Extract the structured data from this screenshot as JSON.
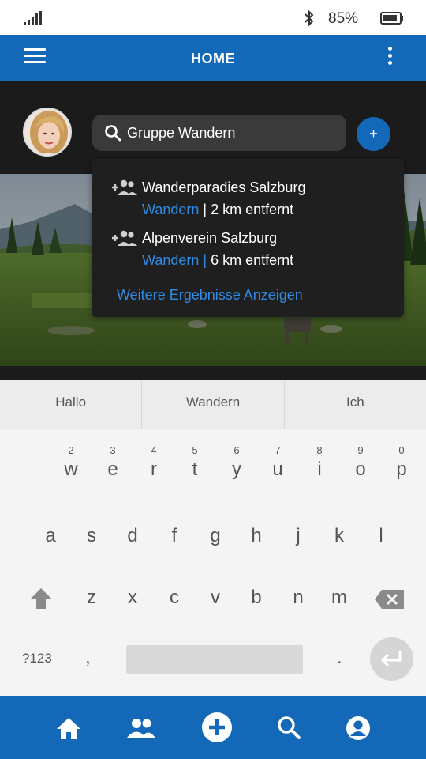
{
  "status_bar": {
    "battery_percent": "85%",
    "icons": [
      "signal-icon",
      "bluetooth-icon",
      "battery-icon"
    ]
  },
  "app_bar": {
    "title": "HOME",
    "left_icon": "menu-icon",
    "right_icon": "more-vert-icon"
  },
  "search": {
    "value": "Gruppe Wandern",
    "add_label": "+"
  },
  "results": [
    {
      "name": "Wanderparadies Salzburg",
      "tag": "Wandern",
      "separator": " | ",
      "distance": "2 km entfernt",
      "icon": "add-group-icon"
    },
    {
      "name": "Alpenverein Salzburg",
      "tag": "Wandern",
      "separator": " | ",
      "distance": "6 km entfernt",
      "icon": "add-group-icon"
    }
  ],
  "more_results_label": "Weitere Ergebnisse Anzeigen",
  "suggestions": [
    "Hallo",
    "Wandern",
    "Ich"
  ],
  "keyboard": {
    "row1_numbers": [
      "2",
      "3",
      "4",
      "5",
      "6",
      "7",
      "8",
      "9",
      "0"
    ],
    "row1": [
      "w",
      "e",
      "r",
      "t",
      "y",
      "u",
      "i",
      "o",
      "p"
    ],
    "row2": [
      "a",
      "s",
      "d",
      "f",
      "g",
      "h",
      "j",
      "k",
      "l"
    ],
    "row3": [
      "z",
      "x",
      "c",
      "v",
      "b",
      "n",
      "m"
    ],
    "symbols_label": "?123",
    "comma": ",",
    "period": "."
  },
  "bottom_nav": [
    "home-icon",
    "group-icon",
    "add-circle-icon",
    "search-icon",
    "account-icon"
  ],
  "colors": {
    "primary": "#1468b8",
    "accent_text": "#2f8be6",
    "dark_bg": "#1b1b1b",
    "dropdown_bg": "#1f1f1f"
  }
}
